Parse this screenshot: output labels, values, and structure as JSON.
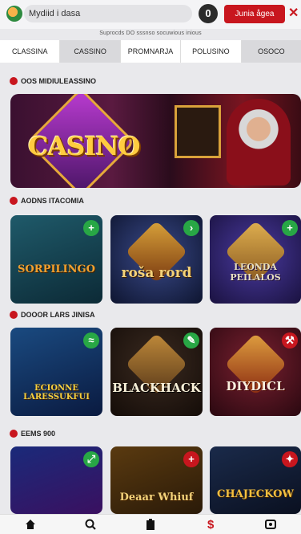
{
  "header": {
    "search_text": "Mydiid i dasa",
    "user_label": "0",
    "join_label": "Junia ågea",
    "close_label": "✕"
  },
  "tagline": "Suprocds DO sssnso socuwious inious",
  "tabs": [
    {
      "label": "CLASSINA"
    },
    {
      "label": "CASSINO"
    },
    {
      "label": "PROMNARJA"
    },
    {
      "label": "POLUSINO"
    },
    {
      "label": "OSOCO"
    }
  ],
  "sections": {
    "s1": "OOS MIDIULEASSINO",
    "s2": "AODNS ITACOMIA",
    "s3": "DOOOR LARS JINISA",
    "s4": "EEMS 900"
  },
  "banner": {
    "title": "CASINO"
  },
  "games_row1": [
    {
      "title": "SORPILINGO"
    },
    {
      "title": "roša rord"
    },
    {
      "title": "LEONDA PEILALOS"
    }
  ],
  "games_row2": [
    {
      "title": "ECIONNE LARESSUKFUI"
    },
    {
      "title": "BLACKHACK"
    },
    {
      "title": "DIYDICL"
    }
  ],
  "games_row3": [
    {
      "title": ""
    },
    {
      "title": "Deaar Whiuf"
    },
    {
      "title": "CHAJECKOW"
    }
  ],
  "colors": {
    "accent": "#c8161e",
    "badge_green": "#28a745"
  },
  "nav_icons": [
    "home-icon",
    "search-icon",
    "clipboard-icon",
    "dollar-icon",
    "profile-icon"
  ]
}
